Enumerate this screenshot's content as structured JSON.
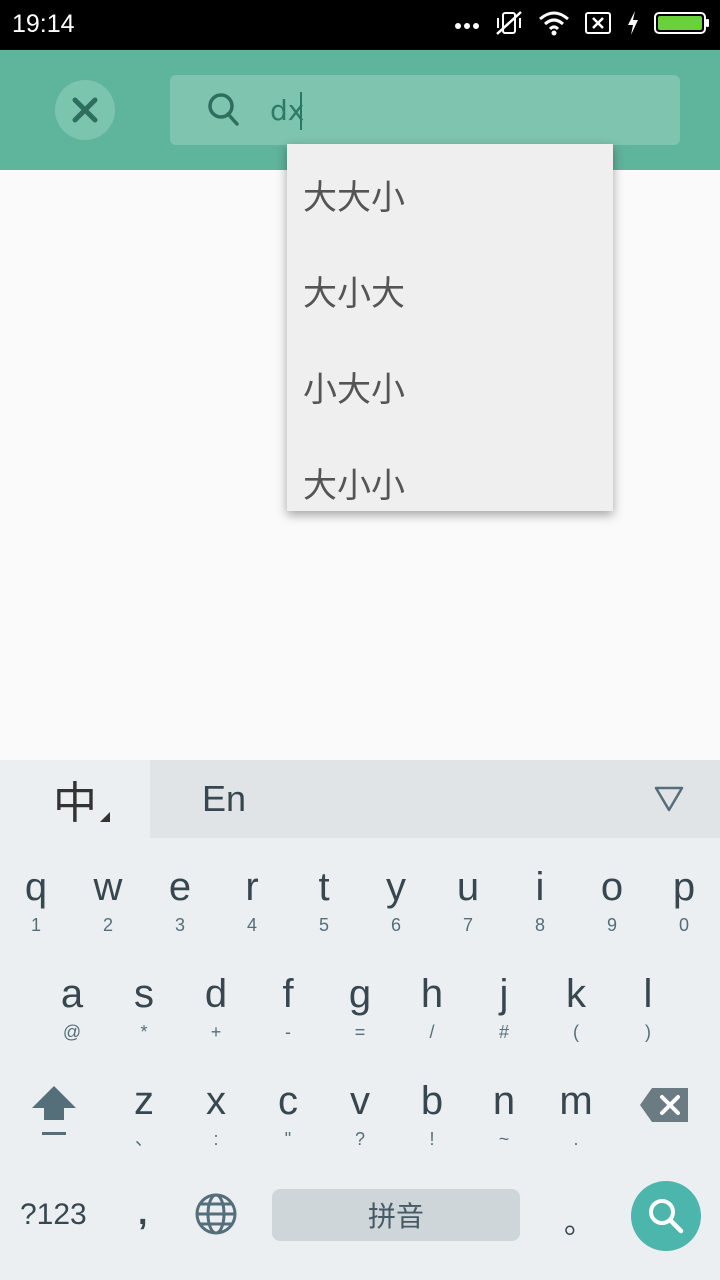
{
  "status_bar": {
    "time": "19:14",
    "icons": [
      "more-icon",
      "vibrate-off-icon",
      "wifi-icon",
      "sim-off-icon",
      "charging-icon",
      "battery-icon"
    ]
  },
  "search": {
    "query": "dx",
    "close_icon": "close-icon",
    "search_icon": "search-icon"
  },
  "suggestions": [
    "大大小",
    "大小大",
    "小大小",
    "大小小"
  ],
  "keyboard": {
    "lang_tab_cn": "中",
    "lang_tab_en": "En",
    "row1": [
      {
        "m": "q",
        "s": "1"
      },
      {
        "m": "w",
        "s": "2"
      },
      {
        "m": "e",
        "s": "3"
      },
      {
        "m": "r",
        "s": "4"
      },
      {
        "m": "t",
        "s": "5"
      },
      {
        "m": "y",
        "s": "6"
      },
      {
        "m": "u",
        "s": "7"
      },
      {
        "m": "i",
        "s": "8"
      },
      {
        "m": "o",
        "s": "9"
      },
      {
        "m": "p",
        "s": "0"
      }
    ],
    "row2": [
      {
        "m": "a",
        "s": "@"
      },
      {
        "m": "s",
        "s": "*"
      },
      {
        "m": "d",
        "s": "+"
      },
      {
        "m": "f",
        "s": "-"
      },
      {
        "m": "g",
        "s": "="
      },
      {
        "m": "h",
        "s": "/"
      },
      {
        "m": "j",
        "s": "#"
      },
      {
        "m": "k",
        "s": "("
      },
      {
        "m": "l",
        "s": ")"
      }
    ],
    "row3": [
      {
        "m": "z",
        "s": "、"
      },
      {
        "m": "x",
        "s": ":"
      },
      {
        "m": "c",
        "s": "\""
      },
      {
        "m": "v",
        "s": "?"
      },
      {
        "m": "b",
        "s": "!"
      },
      {
        "m": "n",
        "s": "~"
      },
      {
        "m": "m",
        "s": "."
      }
    ],
    "symbols_key": "?123",
    "comma_key": ",",
    "space_key": "拼音",
    "period_key": "。"
  },
  "colors": {
    "appbar": "#5fb49c",
    "accent": "#4db6ac",
    "keyboard_bg": "#eceff1"
  }
}
